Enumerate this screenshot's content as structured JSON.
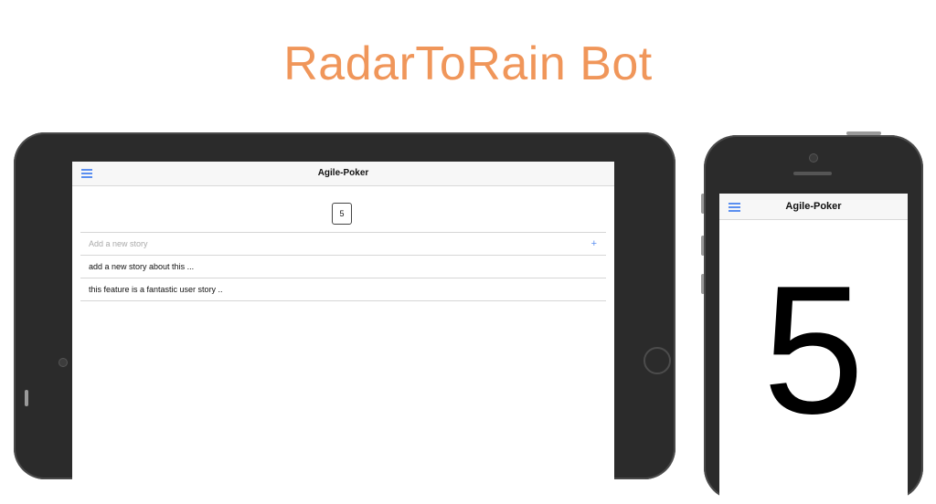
{
  "headline": "RadarToRain Bot",
  "tablet": {
    "nav_title": "Agile-Poker",
    "selected_card": "5",
    "new_story_placeholder": "Add a new story",
    "add_button": "+",
    "stories": [
      "add a new story about this ...",
      "this feature is a fantastic user story .."
    ]
  },
  "phone": {
    "nav_title": "Agile-Poker",
    "big_card": "5"
  },
  "colors": {
    "headline": "#f0965a",
    "accent": "#5b8ff0",
    "device_body": "#2b2b2b"
  },
  "icons": {
    "menu": "hamburger-menu-icon"
  }
}
